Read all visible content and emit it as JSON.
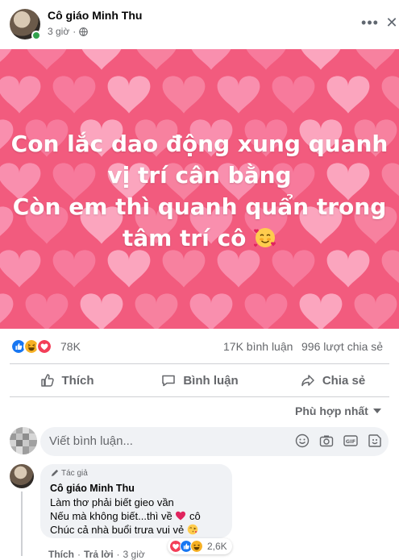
{
  "post": {
    "author": "Cô giáo Minh Thu",
    "time": "3 giờ",
    "privacy_icon": "globe-icon",
    "more_icon": "more-icon",
    "close_icon": "close-icon"
  },
  "image_text": {
    "line1": "Con lắc dao động xung quanh",
    "line2": "vị trí cân bằng",
    "line3": "Còn em thì quanh quẩn trong",
    "line4": "tâm trí cô",
    "emoji": "smiling-face-with-hearts-emoji"
  },
  "stats": {
    "reactions": [
      "like",
      "haha",
      "love"
    ],
    "reaction_count": "78K",
    "comments": "17K bình luận",
    "shares": "996 lượt chia sẻ"
  },
  "actions": {
    "like": "Thích",
    "comment": "Bình luận",
    "share": "Chia sẻ"
  },
  "sort": {
    "label": "Phù hợp nhất"
  },
  "composer": {
    "placeholder": "Viết bình luận...",
    "tools": [
      "emoji-icon",
      "camera-icon",
      "gif-icon",
      "sticker-icon"
    ]
  },
  "comment": {
    "badge": "Tác giả",
    "author": "Cô giáo Minh Thu",
    "line1": "Làm thơ phải biết gieo vần",
    "line2_a": "Nếu mà không biết...thì về",
    "line2_b": "cô",
    "line3": "Chúc cả nhà buổi trưa vui vẻ",
    "reaction_count": "2,6K",
    "like": "Thích",
    "reply": "Trả lời",
    "time": "3 giờ",
    "sep": "·"
  },
  "colors": {
    "background_pink": "#f15a7d",
    "heart_light": "#f98fae",
    "text_secondary": "#65676b",
    "like_blue": "#1877f2",
    "love_red": "#f33e58"
  }
}
